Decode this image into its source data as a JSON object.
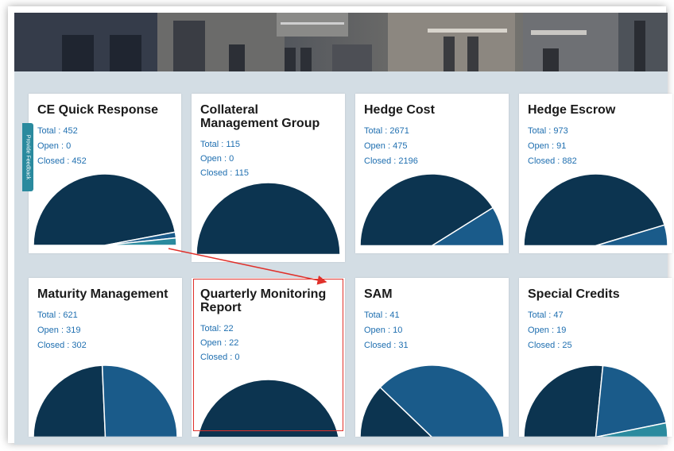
{
  "feedback": {
    "label": "Provide Feedback"
  },
  "colors": {
    "dark": "#0c3450",
    "mid": "#1a5b8a",
    "light": "#2a8a9e",
    "accent": "#e0302a",
    "stat": "#1f6fb0"
  },
  "cards": [
    {
      "title": "CE Quick Response",
      "total": "Total : 452",
      "open": "Open : 0",
      "closed": "Closed : 452",
      "pie": [
        {
          "value": 425,
          "color": "dark"
        },
        {
          "value": 12,
          "color": "mid"
        },
        {
          "value": 15,
          "color": "light"
        }
      ]
    },
    {
      "title": "Collateral Management Group",
      "total": "Total : 115",
      "open": "Open : 0",
      "closed": "Closed : 115",
      "pie": [
        {
          "value": 115,
          "color": "dark"
        }
      ]
    },
    {
      "title": "Hedge Cost",
      "total": "Total : 2671",
      "open": "Open : 475",
      "closed": "Closed : 2196",
      "pie": [
        {
          "value": 2196,
          "color": "dark"
        },
        {
          "value": 475,
          "color": "mid"
        }
      ]
    },
    {
      "title": "Hedge Escrow",
      "total": "Total : 973",
      "open": "Open : 91",
      "closed": "Closed : 882",
      "pie": [
        {
          "value": 882,
          "color": "dark"
        },
        {
          "value": 91,
          "color": "mid"
        }
      ]
    },
    {
      "title": "Maturity Management",
      "total": "Total : 621",
      "open": "Open : 319",
      "closed": "Closed : 302",
      "pie": [
        {
          "value": 302,
          "color": "dark"
        },
        {
          "value": 319,
          "color": "mid"
        }
      ]
    },
    {
      "title": "Quarterly Monitoring Report",
      "total": "Total: 22",
      "open": "Open : 22",
      "closed": "Closed : 0",
      "pie": [
        {
          "value": 22,
          "color": "dark"
        }
      ]
    },
    {
      "title": "SAM",
      "total": "Total : 41",
      "open": "Open : 10",
      "closed": "Closed : 31",
      "pie": [
        {
          "value": 10,
          "color": "dark"
        },
        {
          "value": 31,
          "color": "mid"
        }
      ]
    },
    {
      "title": "Special Credits",
      "total": "Total : 47",
      "open": "Open : 19",
      "closed": "Closed : 25",
      "pie": [
        {
          "value": 25,
          "color": "dark"
        },
        {
          "value": 19,
          "color": "mid"
        },
        {
          "value": 3,
          "color": "light"
        }
      ]
    }
  ]
}
